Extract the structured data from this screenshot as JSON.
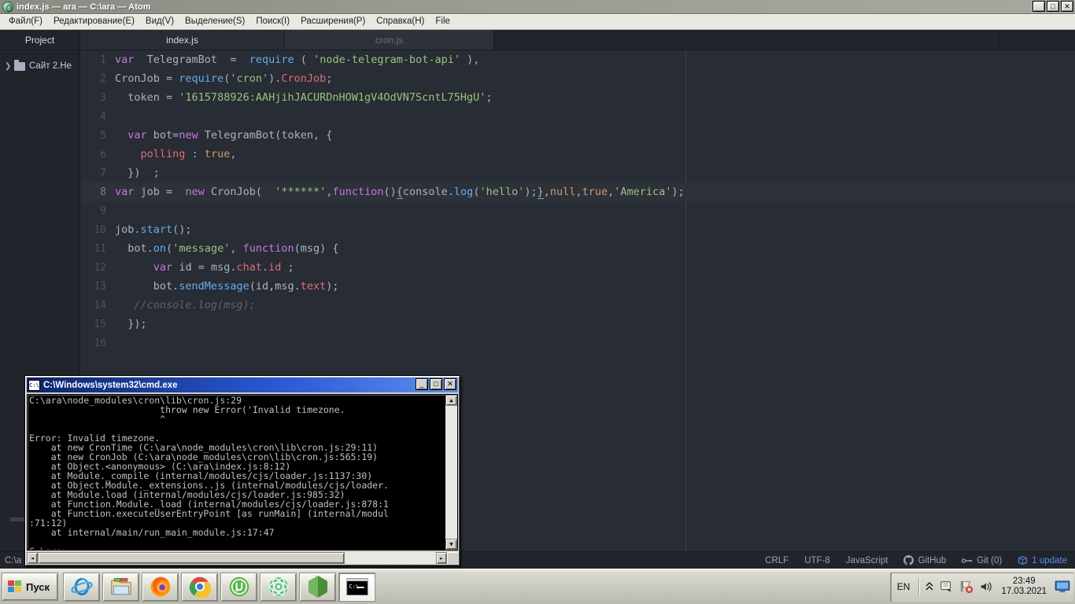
{
  "window": {
    "title": "index.js — ara — C:\\ara — Atom",
    "icon": "atom-logo-icon",
    "controls": {
      "minimize": "_",
      "maximize": "□",
      "close": "✕"
    }
  },
  "menubar": {
    "items": [
      {
        "label": "Файл(F)",
        "mnemonic": "F"
      },
      {
        "label": "Редактирование(E)",
        "mnemonic": "E"
      },
      {
        "label": "Вид(V)",
        "mnemonic": "V"
      },
      {
        "label": "Выделение(S)",
        "mnemonic": "S"
      },
      {
        "label": "Поиск(I)",
        "mnemonic": "I"
      },
      {
        "label": "Расширения(P)",
        "mnemonic": "P"
      },
      {
        "label": "Справка(H)",
        "mnemonic": "H"
      },
      {
        "label": "File",
        "mnemonic": ""
      }
    ]
  },
  "tabs": {
    "project_label": "Project",
    "items": [
      {
        "label": "index.js",
        "active": true
      },
      {
        "label": "cron.js",
        "active": false
      }
    ]
  },
  "tree": {
    "items": [
      {
        "label": "Сайт 2.Не",
        "expanded": false,
        "icon": "folder-icon",
        "arrow": "❯"
      }
    ]
  },
  "editor": {
    "file": "index.js",
    "active_line": 8,
    "lines": [
      {
        "n": 1,
        "text": "var  TelegramBot  =  require ( 'node-telegram-bot-api' ),"
      },
      {
        "n": 2,
        "text": "CronJob = require('cron').CronJob;"
      },
      {
        "n": 3,
        "text": "  token = '1615788926:AAHjihJACURDnHOW1gV4OdVN7ScntL75HgU';"
      },
      {
        "n": 4,
        "text": ""
      },
      {
        "n": 5,
        "text": "  var bot=new TelegramBot(token, {"
      },
      {
        "n": 6,
        "text": "    polling : true,"
      },
      {
        "n": 7,
        "text": "  })  ;"
      },
      {
        "n": 8,
        "text": "var job =  new CronJob(  '******',function(){console.log('hello');},null,true,'America');"
      },
      {
        "n": 9,
        "text": ""
      },
      {
        "n": 10,
        "text": "job.start();"
      },
      {
        "n": 11,
        "text": "  bot.on('message', function(msg) {"
      },
      {
        "n": 12,
        "text": "      var id = msg.chat.id ;"
      },
      {
        "n": 13,
        "text": "      bot.sendMessage(id,msg.text);"
      },
      {
        "n": 14,
        "text": "   //console.log(msg);"
      },
      {
        "n": 15,
        "text": "  });"
      },
      {
        "n": 16,
        "text": ""
      }
    ]
  },
  "statusbar": {
    "path": "C:\\a",
    "line_ending": "CRLF",
    "encoding": "UTF-8",
    "grammar": "JavaScript",
    "github": "GitHub",
    "git": "Git (0)",
    "updates": "1 update"
  },
  "cmd": {
    "title": "C:\\Windows\\system32\\cmd.exe",
    "icon": "cmd-icon",
    "controls": {
      "minimize": "_",
      "maximize": "□",
      "close": "✕"
    },
    "output": "C:\\ara\\node_modules\\cron\\lib\\cron.js:29\n                        throw new Error('Invalid timezone.\n                        ^\n\nError: Invalid timezone.\n    at new CronTime (C:\\ara\\node_modules\\cron\\lib\\cron.js:29:11)\n    at new CronJob (C:\\ara\\node_modules\\cron\\lib\\cron.js:565:19)\n    at Object.<anonymous> (C:\\ara\\index.js:8:12)\n    at Module._compile (internal/modules/cjs/loader.js:1137:30)\n    at Object.Module._extensions..js (internal/modules/cjs/loader.\n    at Module.load (internal/modules/cjs/loader.js:985:32)\n    at Function.Module._load (internal/modules/cjs/loader.js:878:1\n    at Function.executeUserEntryPoint [as runMain] (internal/modul\n:71:12)\n    at internal/main/run_main_module.js:17:47\n\nC:\\ara>"
  },
  "taskbar": {
    "start_label": "Пуск",
    "buttons": [
      {
        "name": "internet-explorer-icon",
        "label": "Internet Explorer",
        "active": false
      },
      {
        "name": "file-explorer-icon",
        "label": "Проводник",
        "active": false
      },
      {
        "name": "firefox-icon",
        "label": "Mozilla Firefox",
        "active": false
      },
      {
        "name": "chrome-icon",
        "label": "Google Chrome",
        "active": false
      },
      {
        "name": "utorrent-icon",
        "label": "uTorrent",
        "active": false
      },
      {
        "name": "atom-icon",
        "label": "Atom",
        "active": false
      },
      {
        "name": "nodejs-icon",
        "label": "Node.js",
        "active": false
      },
      {
        "name": "cmd-icon",
        "label": "cmd.exe",
        "active": true
      }
    ],
    "tray": {
      "language": "EN",
      "show_hidden": "^",
      "time": "23:49",
      "date": "17.03.2021"
    }
  },
  "colors": {
    "editor_bg": "#282c34",
    "editor_chrome": "#21252b",
    "active_line": "#2c313a",
    "accent_blue": "#568af2",
    "titlebar_blue": "#0a246a",
    "taskbar_gray": "#c9c9c0"
  }
}
